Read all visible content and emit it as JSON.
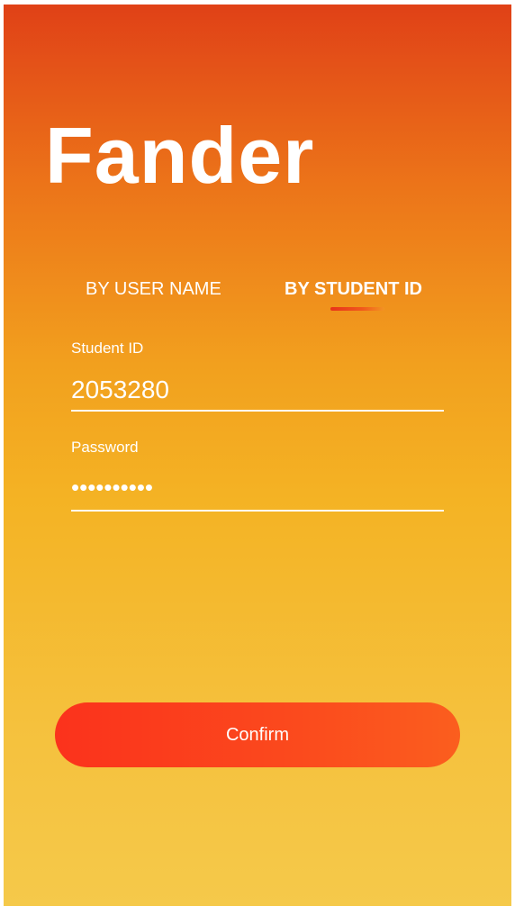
{
  "app": {
    "title": "Fander"
  },
  "tabs": [
    {
      "label": "BY USER NAME",
      "active": false
    },
    {
      "label": "BY STUDENT ID",
      "active": true
    }
  ],
  "form": {
    "student_id": {
      "label": "Student ID",
      "value": "2053280"
    },
    "password": {
      "label": "Password",
      "value": "••••••••••"
    },
    "confirm_label": "Confirm"
  },
  "colors": {
    "gradient_top": "#e04117",
    "gradient_mid": "#f4b324",
    "gradient_bottom": "#f5c94a",
    "button": "#fb3a1c",
    "text": "#ffffff"
  }
}
